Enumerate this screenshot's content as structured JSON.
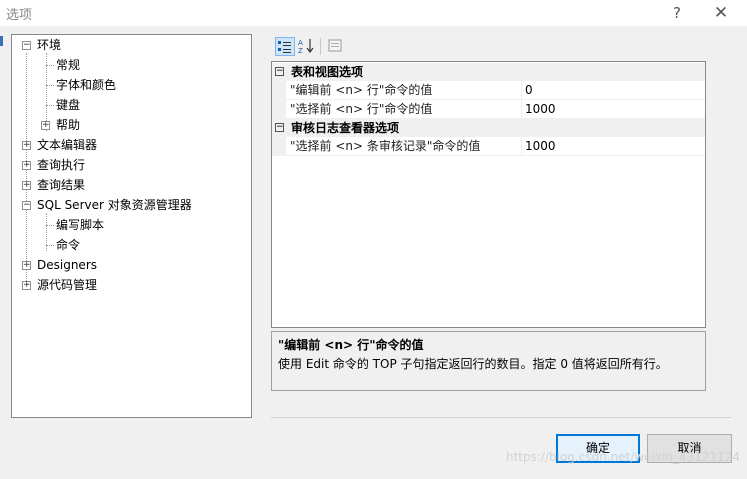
{
  "dialog": {
    "title": "选项",
    "help": "?",
    "close": "✕"
  },
  "tree": {
    "nodes": [
      {
        "label": "环境",
        "expander": "−"
      },
      {
        "label": "常规"
      },
      {
        "label": "字体和颜色"
      },
      {
        "label": "键盘"
      },
      {
        "label": "帮助",
        "expander": "+"
      },
      {
        "label": "文本编辑器",
        "expander": "+"
      },
      {
        "label": "查询执行",
        "expander": "+"
      },
      {
        "label": "查询结果",
        "expander": "+"
      },
      {
        "label": "SQL Server 对象资源管理器",
        "expander": "−"
      },
      {
        "label": "编写脚本"
      },
      {
        "label": "命令"
      },
      {
        "label": "Designers",
        "expander": "+"
      },
      {
        "label": "源代码管理",
        "expander": "+"
      }
    ]
  },
  "toolbar": {
    "categorized_icon": "categorized-icon",
    "alphabetical_icon": "alphabetical-icon",
    "property_pages_icon": "property-pages-icon",
    "az_text": "A Z"
  },
  "grid": {
    "categories": [
      {
        "label": "表和视图选项",
        "expander": "−",
        "rows": [
          {
            "name": "\"编辑前 <n> 行\"命令的值",
            "value": "0"
          },
          {
            "name": "\"选择前 <n> 行\"命令的值",
            "value": "1000"
          }
        ]
      },
      {
        "label": "审核日志查看器选项",
        "expander": "−",
        "rows": [
          {
            "name": "\"选择前 <n> 条审核记录\"命令的值",
            "value": "1000"
          }
        ]
      }
    ]
  },
  "description": {
    "title": "\"编辑前 <n> 行\"命令的值",
    "text": "使用 Edit 命令的 TOP 子句指定返回行的数目。指定 0 值将返回所有行。"
  },
  "buttons": {
    "ok": "确定",
    "cancel": "取消"
  },
  "watermark": "https://blog.csdn.net/weixin_43121124",
  "colors": {
    "accent": "#0078d7",
    "selection": "#cce4f7"
  }
}
